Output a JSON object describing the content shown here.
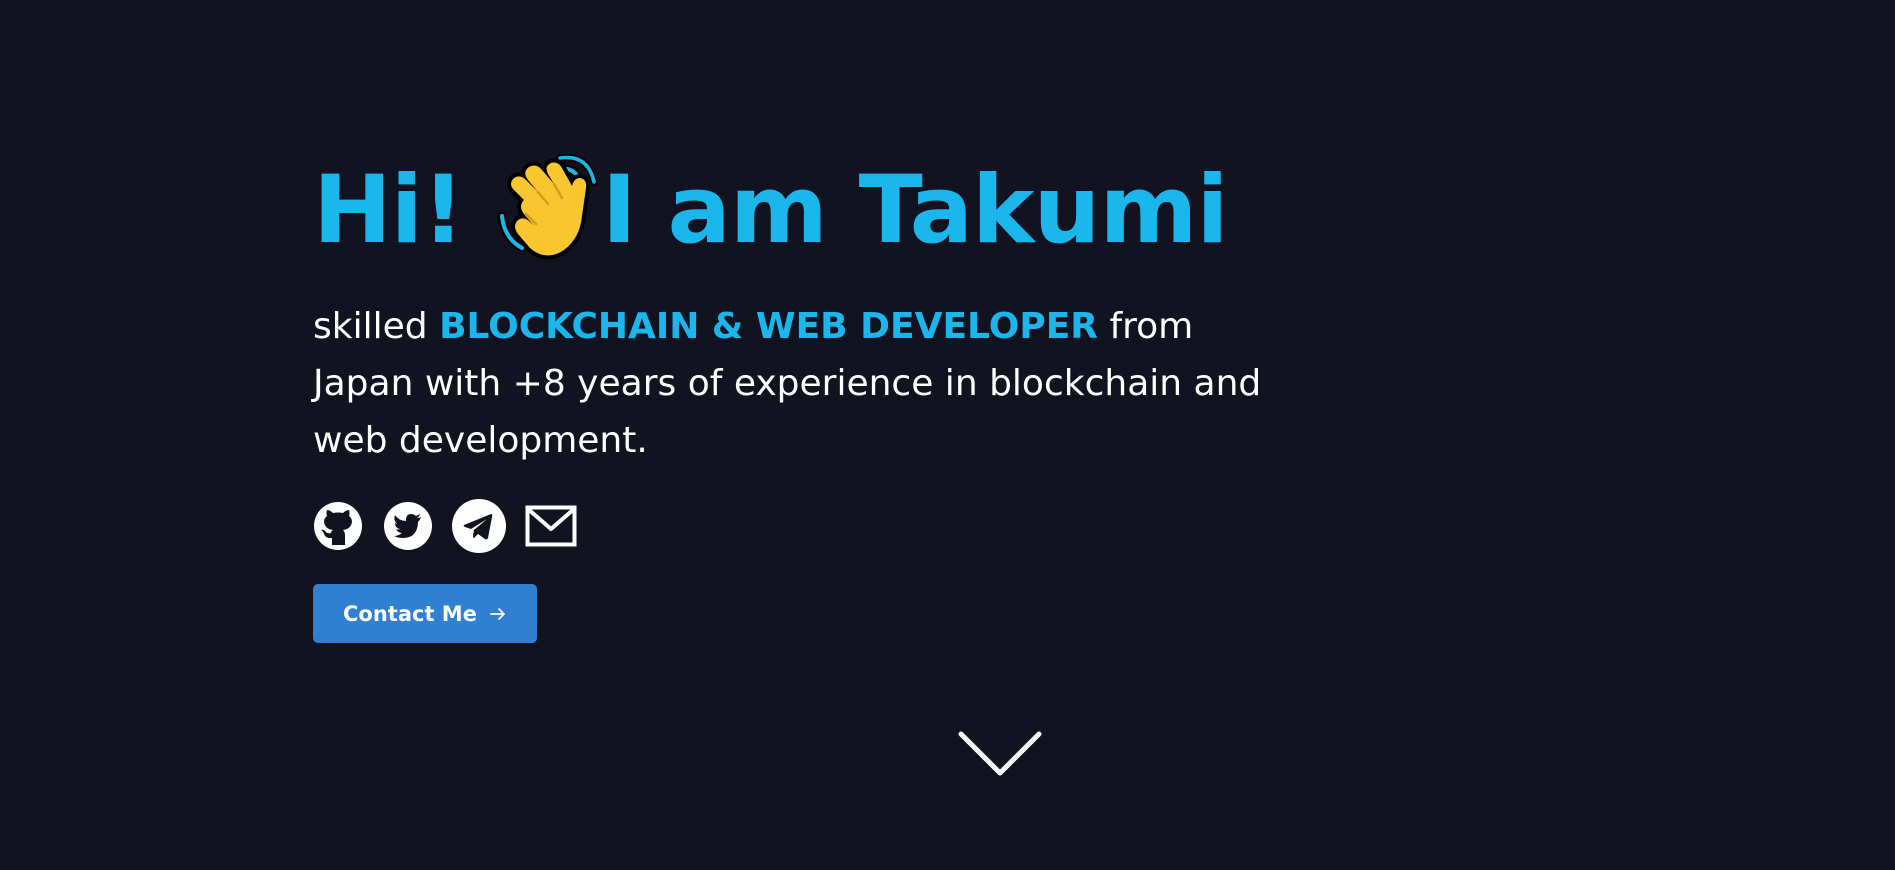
{
  "hero": {
    "greeting": "Hi!",
    "wave_icon": "waving-hand-emoji",
    "name_line": "I am Takumi",
    "tagline_prefix": "skilled ",
    "role": "BLOCKCHAIN & WEB DEVELOPER",
    "tagline_suffix": " from Japan with +8 years of experience in blockchain and web development."
  },
  "socials": [
    {
      "name": "github",
      "icon": "github-icon"
    },
    {
      "name": "twitter",
      "icon": "twitter-icon"
    },
    {
      "name": "telegram",
      "icon": "telegram-icon"
    },
    {
      "name": "email",
      "icon": "mail-icon"
    }
  ],
  "cta": {
    "label": "Contact Me",
    "icon": "arrow-right-icon"
  },
  "scroll": {
    "icon": "chevron-down-icon"
  },
  "colors": {
    "background": "#111420",
    "accent": "#1ab6ec",
    "button": "#2f80d0",
    "text": "#ffffff"
  }
}
